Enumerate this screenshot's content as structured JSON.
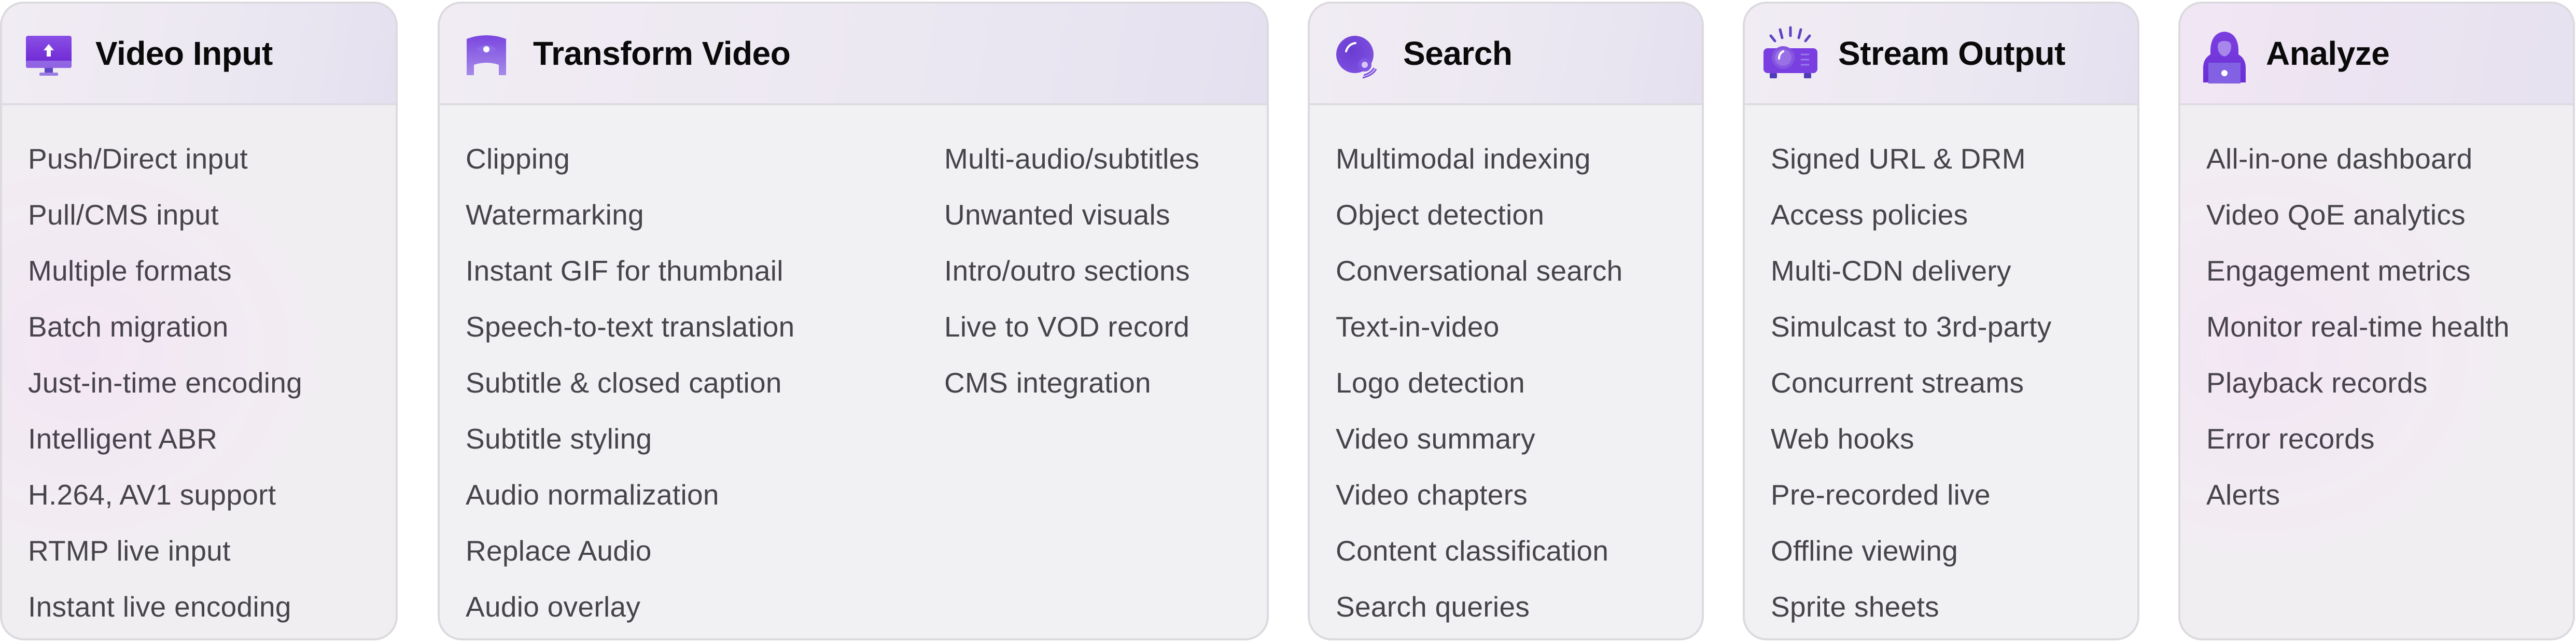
{
  "colors": {
    "accent_purple": "#6b2fd6",
    "title_text": "#0a0a0a",
    "item_text": "#46434b",
    "card_border": "#dcdadf"
  },
  "cards": [
    {
      "title": "Video Input",
      "icon": "monitor-upload-icon",
      "items": [
        "Push/Direct input",
        "Pull/CMS input",
        "Multiple formats",
        "Batch migration",
        "Just-in-time encoding",
        "Intelligent ABR",
        "H.264, AV1 support",
        "RTMP live input",
        "Instant live encoding"
      ]
    },
    {
      "title": "Transform Video",
      "icon": "eye-shield-icon",
      "items": [
        "Clipping",
        "Watermarking",
        "Instant GIF for thumbnail",
        "Speech-to-text translation",
        "Subtitle & closed caption",
        "Subtitle styling",
        "Audio normalization",
        "Replace Audio",
        "Audio overlay"
      ],
      "items_col2": [
        "Multi-audio/subtitles",
        "Unwanted visuals",
        "Intro/outro sections",
        "Live to VOD record",
        "CMS integration"
      ]
    },
    {
      "title": "Search",
      "icon": "magnifier-orb-icon",
      "items": [
        "Multimodal indexing",
        "Object detection",
        "Conversational search",
        "Text-in-video",
        "Logo detection",
        "Video summary",
        "Video chapters",
        "Content classification",
        "Search queries"
      ]
    },
    {
      "title": "Stream Output",
      "icon": "projector-icon",
      "items": [
        "Signed URL & DRM",
        "Access policies",
        "Multi-CDN delivery",
        "Simulcast to 3rd-party",
        "Concurrent streams",
        "Web hooks",
        "Pre-recorded live",
        "Offline viewing",
        "Sprite sheets"
      ]
    },
    {
      "title": "Analyze",
      "icon": "hooded-analyst-icon",
      "items": [
        "All-in-one dashboard",
        "Video QoE analytics",
        "Engagement metrics",
        "Monitor real-time health",
        "Playback records",
        "Error records",
        "Alerts"
      ]
    }
  ]
}
